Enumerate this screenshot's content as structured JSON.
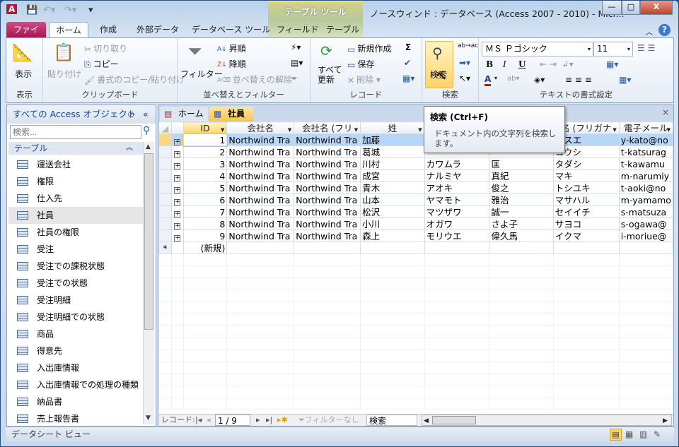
{
  "window": {
    "title": "ノースウィンド : データベース (Access 2007 - 2010)  -  Micr...",
    "context_tab_group": "テーブル ツール",
    "minimize": "—",
    "maximize": "□",
    "close": "X"
  },
  "tabs": {
    "file": "ファイル",
    "home": "ホーム",
    "create": "作成",
    "external": "外部データ",
    "dbtools": "データベース ツール",
    "field": "フィールド",
    "table": "テーブル"
  },
  "ribbon": {
    "view": {
      "label": "表示",
      "group": "表示"
    },
    "clipboard": {
      "paste": "貼り付け",
      "cut": "切り取り",
      "copy": "コピー",
      "format_painter": "書式のコピー/貼り付け",
      "group": "クリップボード"
    },
    "sort": {
      "filter": "フィルター",
      "asc": "昇順",
      "desc": "降順",
      "clear": "並べ替えの解除",
      "group": "並べ替えとフィルター"
    },
    "records": {
      "refresh": "すべて\n更新",
      "new": "新規作成",
      "save": "保存",
      "delete": "削除",
      "totals": "Σ",
      "group": "レコード"
    },
    "find": {
      "find": "検索",
      "group": "検索"
    },
    "text": {
      "font": "ＭＳ Ｐゴシック",
      "size": "11",
      "bold": "B",
      "italic": "I",
      "underline": "U",
      "group": "テキストの書式設定"
    }
  },
  "nav": {
    "header": "すべての Access オブジェクト",
    "search_placeholder": "検索...",
    "group": "テーブル",
    "items": [
      "運送会社",
      "権限",
      "仕入先",
      "社員",
      "社員の権限",
      "受注",
      "受注での課税状態",
      "受注での状態",
      "受注明細",
      "受注明細での状態",
      "商品",
      "得意先",
      "入出庫情報",
      "入出庫情報での処理の種類",
      "納品書",
      "売上報告書"
    ],
    "selected": "社員"
  },
  "doc_tabs": {
    "home": "ホーム",
    "employees": "社員",
    "close": "×"
  },
  "table": {
    "columns": [
      "ID",
      "会社名",
      "会社名 (フリ",
      "姓",
      "",
      "",
      "名 (フリガナ",
      "電子メール"
    ],
    "rows": [
      [
        "1",
        "Northwind Tra",
        "Northwind Tra",
        "加藤",
        "",
        "",
        "アスエ",
        "y-kato@no"
      ],
      [
        "2",
        "Northwind Tra",
        "Northwind Tra",
        "葛城",
        "",
        "",
        "コウシ",
        "t-katsurag"
      ],
      [
        "3",
        "Northwind Tra",
        "Northwind Tra",
        "川村",
        "カワムラ",
        "匡",
        "タダシ",
        "t-kawamu"
      ],
      [
        "4",
        "Northwind Tra",
        "Northwind Tra",
        "成宮",
        "ナルミヤ",
        "真紀",
        "マキ",
        "m-narumiy"
      ],
      [
        "5",
        "Northwind Tra",
        "Northwind Tra",
        "青木",
        "アオキ",
        "俊之",
        "トシユキ",
        "t-aoki@no"
      ],
      [
        "6",
        "Northwind Tra",
        "Northwind Tra",
        "山本",
        "ヤマモト",
        "雅治",
        "マサハル",
        "m-yamamo"
      ],
      [
        "7",
        "Northwind Tra",
        "Northwind Tra",
        "松沢",
        "マツザワ",
        "誠一",
        "セイイチ",
        "s-matsuza"
      ],
      [
        "8",
        "Northwind Tra",
        "Northwind Tra",
        "小川",
        "オガワ",
        "さよ子",
        "サヨコ",
        "s-ogawa@"
      ],
      [
        "9",
        "Northwind Tra",
        "Northwind Tra",
        "森上",
        "モリウエ",
        "偉久馬",
        "イクマ",
        "i-moriue@"
      ]
    ],
    "new_row": "(新規)",
    "new_marker": "*"
  },
  "tooltip": {
    "title": "検索 (Ctrl+F)",
    "body": "ドキュメント内の文字列を検索します。"
  },
  "record_nav": {
    "label": "レコード:",
    "position": "1 / 9",
    "filter": "フィルターなし",
    "search": "検索"
  },
  "status": {
    "text": "データシート ビュー"
  }
}
